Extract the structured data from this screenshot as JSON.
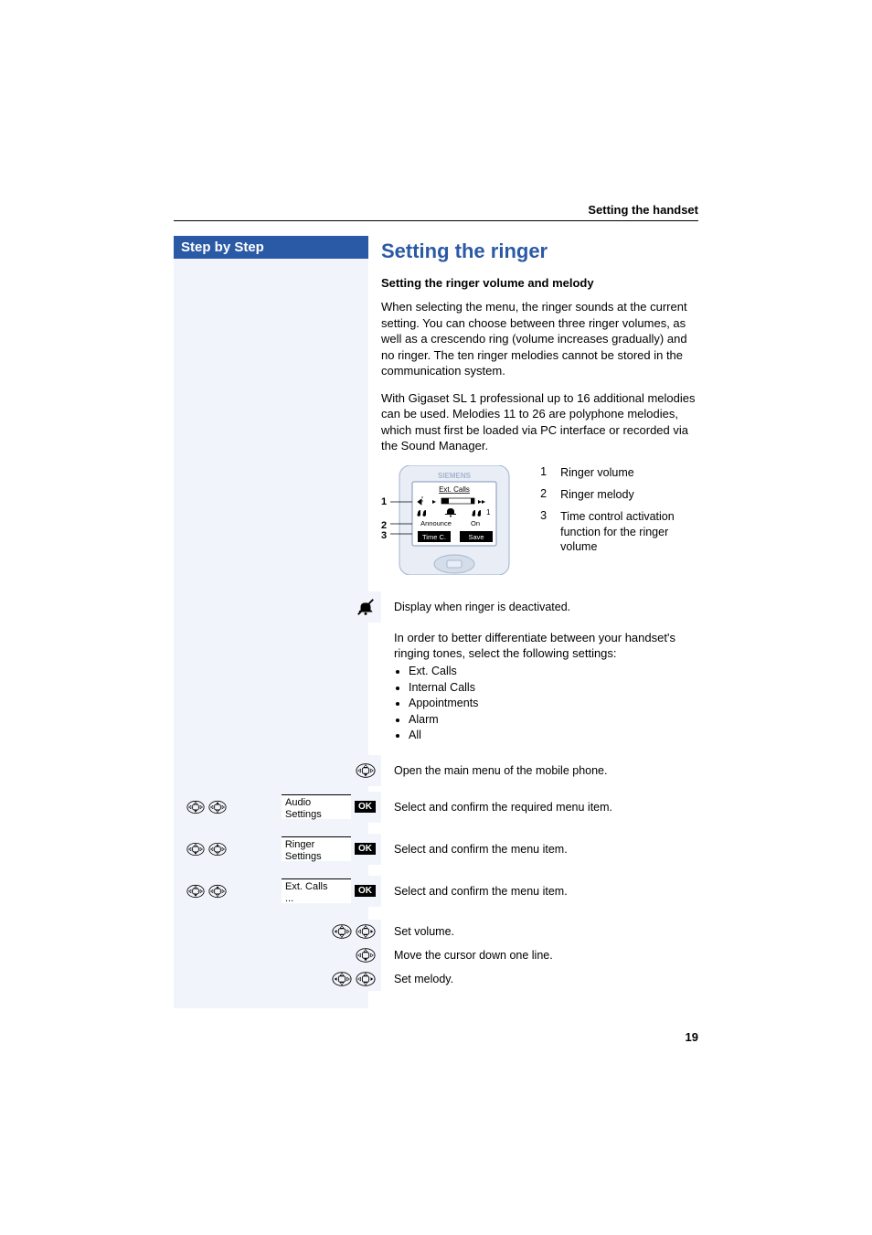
{
  "running_head": "Setting the handset",
  "step_header": "Step by Step",
  "section_title": "Setting the ringer",
  "sub_heading": "Setting the ringer volume and melody",
  "para1": "When selecting the menu, the ringer sounds at the current setting. You can choose between three ringer volumes, as well as a crescendo ring (volume increases gradually) and no ringer. The ten ringer melodies cannot be stored in the communication system.",
  "para2": "With Gigaset SL 1 professional up to 16 additional melodies can be used. Melodies 11 to 26 are polyphone melodies, which must first be loaded via PC interface or recorded via the Sound Manager.",
  "phone": {
    "brand": "SIEMENS",
    "title": "Ext. Calls",
    "announce": "Announce",
    "on": "On",
    "time_c": "Time C.",
    "save": "Save",
    "melody_num": "1",
    "leader_1": "1",
    "leader_2": "2",
    "leader_3": "3"
  },
  "legend": {
    "n1": "1",
    "t1": "Ringer volume",
    "n2": "2",
    "t2": "Ringer melody",
    "n3": "3",
    "t3": "Time control activation function for the ringer volume"
  },
  "note_text": "Display when ringer is deactivated.",
  "para3_lead": "In order to better differentiate between your handset's ringing tones, select the following settings:",
  "bullets": {
    "b1": "Ext. Calls",
    "b2": "Internal Calls",
    "b3": "Appointments",
    "b4": "Alarm",
    "b5": "All"
  },
  "steps": {
    "s0": "Open the main menu of the mobile phone.",
    "s1_label": "Audio Settings",
    "s1_ok": "OK",
    "s1_desc": "Select and confirm the required menu item.",
    "s2_label": "Ringer Settings",
    "s2_ok": "OK",
    "s2_desc": "Select and confirm the menu item.",
    "s3_label": "Ext. Calls",
    "s3_label_sub": "...",
    "s3_ok": "OK",
    "s3_desc": "Select and confirm the menu item.",
    "s4_desc": "Set volume.",
    "s5_desc": "Move the cursor down one line.",
    "s6_desc": "Set melody."
  },
  "page_number": "19"
}
